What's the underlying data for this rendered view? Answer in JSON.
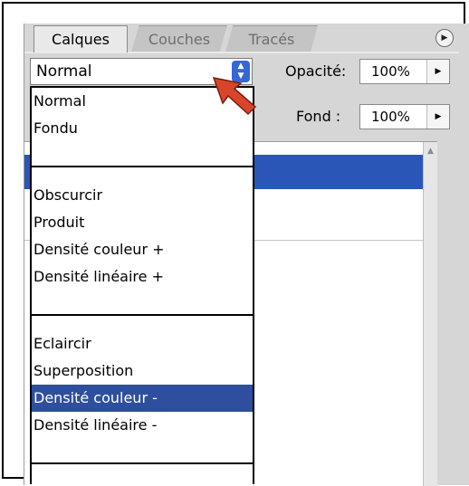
{
  "tabs": [
    {
      "label": "Calques",
      "active": true
    },
    {
      "label": "Couches",
      "active": false
    },
    {
      "label": "Tracés",
      "active": false
    }
  ],
  "panel_menu_icon": "triangle-right-icon",
  "blend_mode": {
    "value": "Normal",
    "arrow_icon": "up-down-arrows-icon"
  },
  "opacity": {
    "label": "Opacité:",
    "value": "100%"
  },
  "fill": {
    "label": "Fond :",
    "value": "100%"
  },
  "dropdown": {
    "groups": [
      [
        "Normal",
        "Fondu"
      ],
      [
        "Obscurcir",
        "Produit",
        "Densité couleur +",
        "Densité linéaire +"
      ],
      [
        "Eclaircir",
        "Superposition",
        "Densité couleur -",
        "Densité linéaire -"
      ]
    ],
    "selected": "Densité couleur -"
  },
  "colors": {
    "selection": "#2e4f9e",
    "layer_highlight": "#2a56b8",
    "arrow_button": "#3568d4",
    "pointer": "#d9452b"
  }
}
